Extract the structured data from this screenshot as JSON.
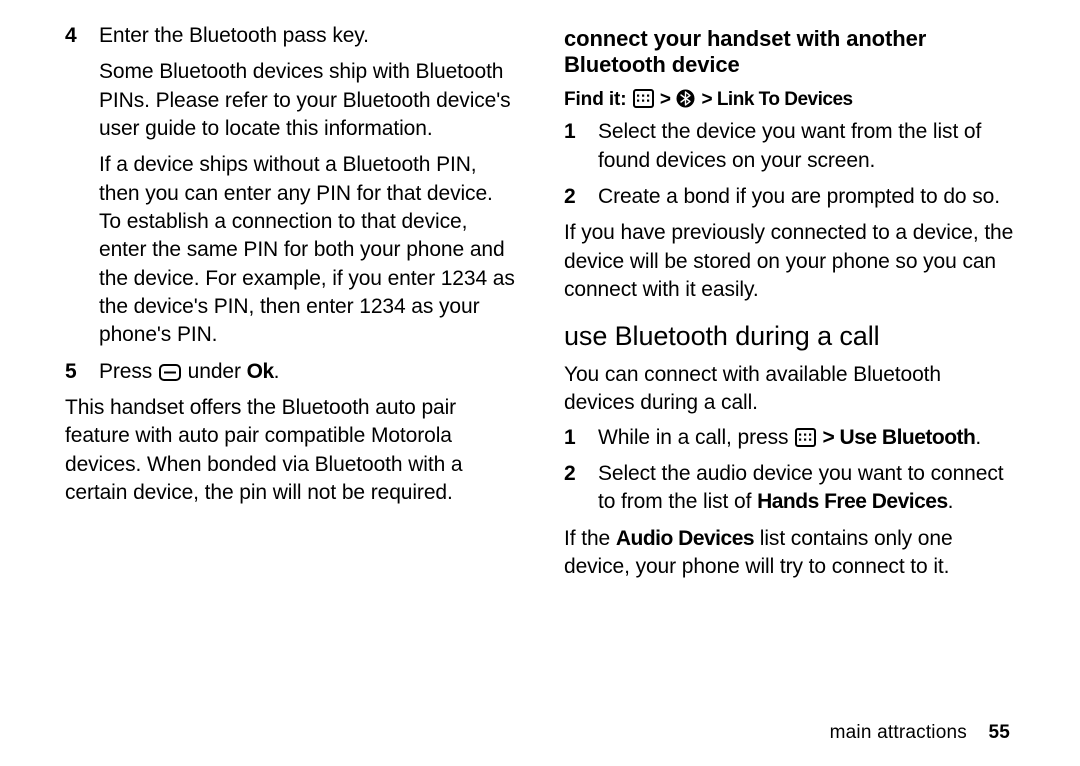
{
  "left": {
    "item4": {
      "num": "4",
      "line1": "Enter the Bluetooth pass key.",
      "para1": "Some Bluetooth devices ship with Bluetooth PINs. Please refer to your Bluetooth device's user guide to locate this information.",
      "para2": "If a device ships without a Bluetooth PIN, then you can enter any PIN for that device. To establish a connection to that device, enter the same PIN for both your phone and the device. For example, if you enter 1234 as the device's PIN, then enter 1234 as your phone's PIN."
    },
    "item5": {
      "num": "5",
      "pre": "Press ",
      "under": " under ",
      "ok": "Ok",
      "dot": "."
    },
    "tail": "This handset offers the Bluetooth auto pair feature with auto pair compatible Motorola devices. When bonded via Bluetooth with a certain device, the pin will not be required."
  },
  "right": {
    "heading_connect": "connect your handset with another Bluetooth device",
    "findit_label": "Find it:",
    "findit_tail": "Link To Devices",
    "gt": " > ",
    "c1": {
      "num": "1",
      "text": "Select the device you want from the list of found devices on your screen."
    },
    "c2": {
      "num": "2",
      "text": "Create a bond if you are prompted to do so."
    },
    "c_after": "If you have previously connected to a device, the device will be stored on your phone so you can connect with it easily.",
    "heading_use": "use Bluetooth during a call",
    "use_intro": "You can connect with available Bluetooth devices during a call.",
    "u1": {
      "num": "1",
      "pre": "While in a call, press ",
      "gt": " > ",
      "ub": "Use Bluetooth",
      "dot": "."
    },
    "u2": {
      "num": "2",
      "pre": "Select the audio device you want to connect to from the list of ",
      "hfd": "Hands Free Devices",
      "dot": "."
    },
    "u_after_pre": "If the ",
    "u_after_ad": "Audio Devices",
    "u_after_post": " list contains only one device, your phone will try to connect to it."
  },
  "footer": {
    "section": "main attractions",
    "page": "55"
  }
}
